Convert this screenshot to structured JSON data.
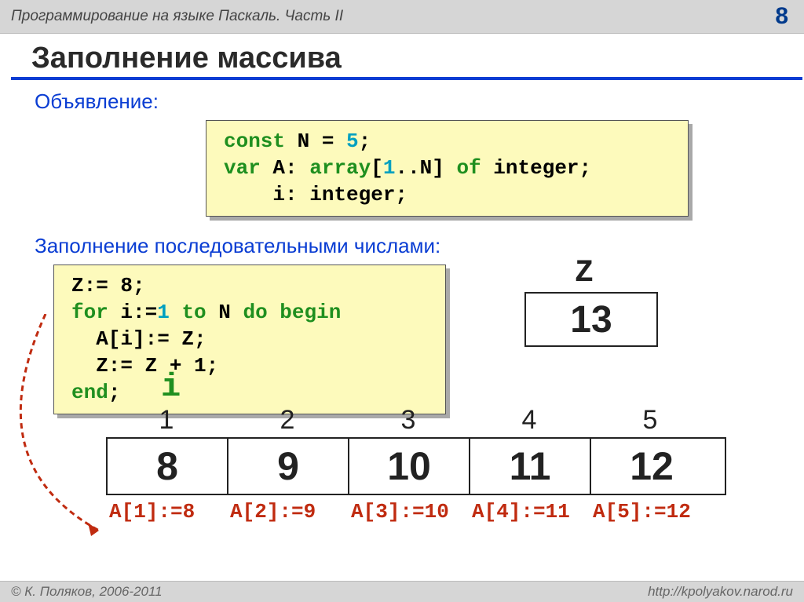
{
  "header": {
    "title": "Программирование на языке Паскаль. Часть II",
    "page": "8"
  },
  "main": {
    "title": "Заполнение массива",
    "sub1": "Объявление:",
    "sub2": "Заполнение последовательными числами:"
  },
  "code1": {
    "l1a": "const",
    "l1b": " N = ",
    "l1c": "5",
    "l1d": ";",
    "l2a": "var",
    "l2b": " A: ",
    "l2c": "array",
    "l2d": "[",
    "l2e": "1",
    "l2f": "..N] ",
    "l2g": "of",
    "l2h": " integer;",
    "l3": "    i: integer;"
  },
  "code2": {
    "l1": "Z:= 8;",
    "l2a": "for",
    "l2b": " i:=",
    "l2c": "1",
    "l2d": " ",
    "l2e": "to",
    "l2f": " N ",
    "l2g": "do begin",
    "l3": "  A[i]:= Z;",
    "l4": "  Z:= Z + 1;",
    "l5": "end",
    "l5b": ";"
  },
  "z": {
    "label": "Z",
    "value": "13"
  },
  "i_label": "i",
  "array": {
    "idx": [
      "1",
      "2",
      "3",
      "4",
      "5"
    ],
    "val": [
      "8",
      "9",
      "10",
      "11",
      "12"
    ],
    "assign": [
      "A[1]:=8",
      "A[2]:=9",
      "A[3]:=10",
      "A[4]:=11",
      "A[5]:=12"
    ]
  },
  "footer": {
    "left": "© К. Поляков, 2006-2011",
    "right": "http://kpolyakov.narod.ru"
  }
}
